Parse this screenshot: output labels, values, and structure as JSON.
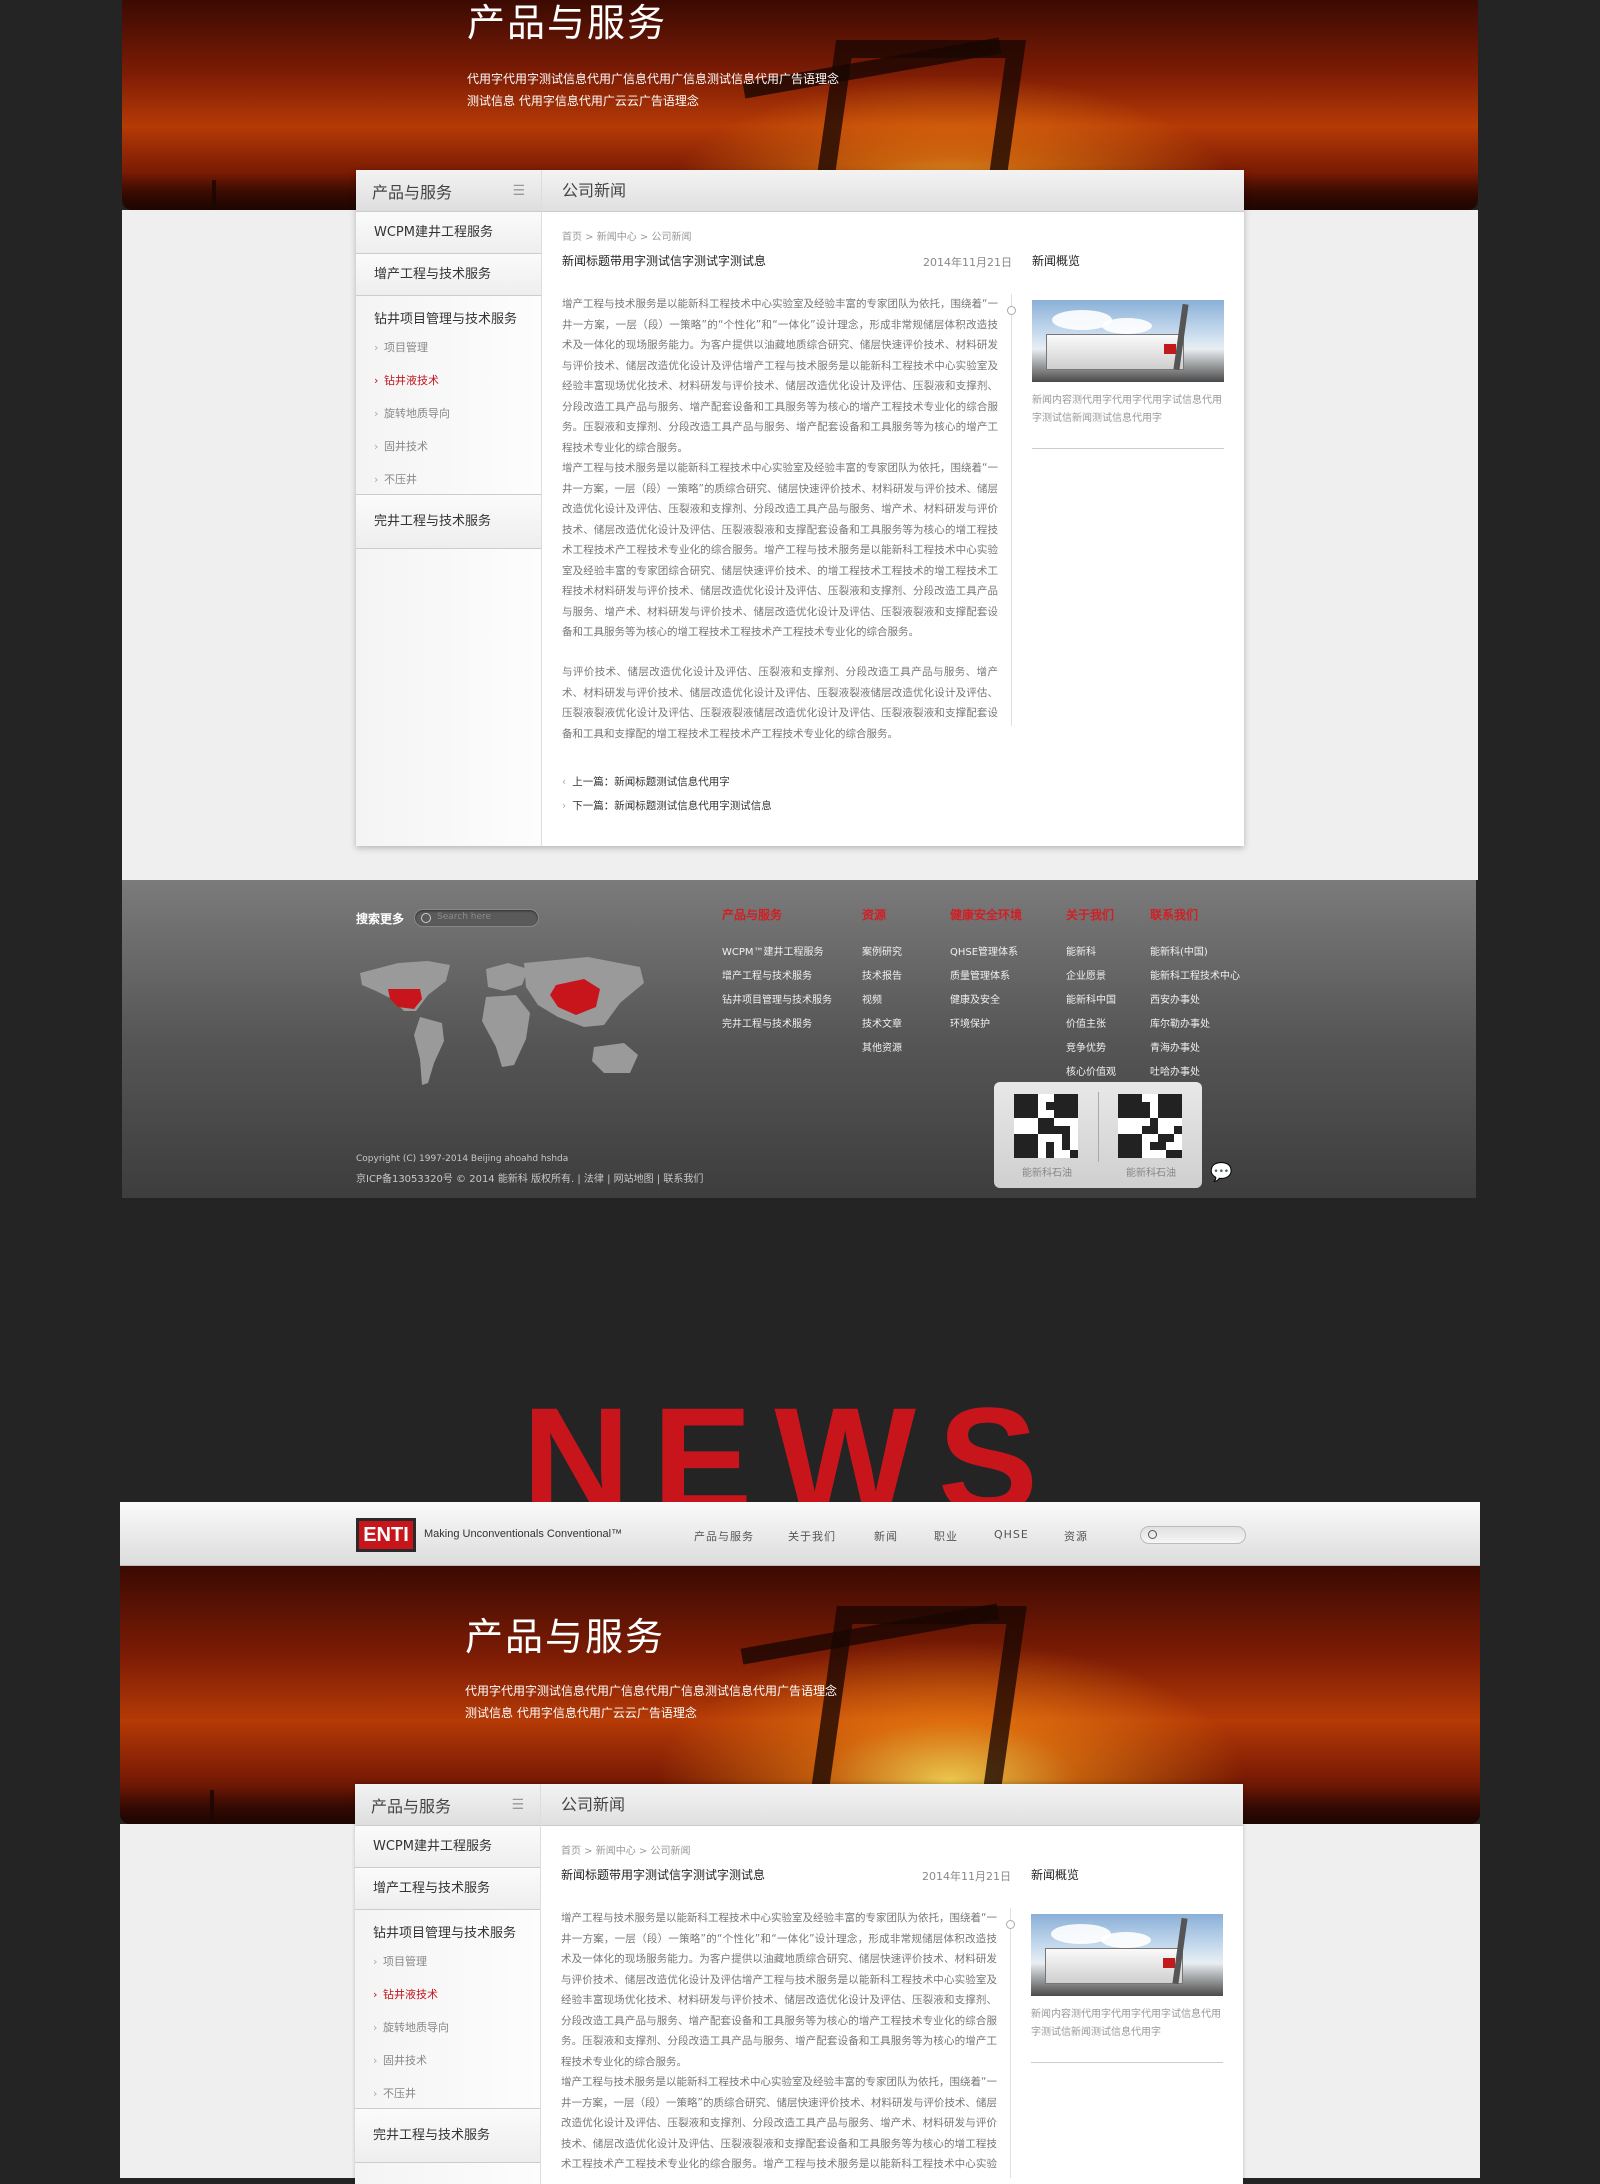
{
  "hero": {
    "title": "产品与服务",
    "desc_line1": "代用字代用字测试信息代用广信息代用广信息测试信息代用广告语理念",
    "desc_line2": "测试信息 代用字信息代用广云云广告语理念"
  },
  "sidebar": {
    "heading": "产品与服务",
    "items": [
      "WCPM建井工程服务",
      "增产工程与技术服务",
      "钻井项目管理与技术服务",
      "完井工程与技术服务"
    ],
    "subitems": [
      "项目管理",
      "钻井液技术",
      "旋转地质导向",
      "固井技术",
      "不压井"
    ],
    "active_subitem": "钻井液技术"
  },
  "article": {
    "section_title": "公司新闻",
    "breadcrumb": "首页 > 新闻中心 > 公司新闻",
    "title": "新闻标题带用字测试信字测试字测试息",
    "date": "2014年11月21日",
    "paragraphs": [
      "增产工程与技术服务是以能新科工程技术中心实验室及经验丰富的专家团队为依托，围绕着“一井一方案，一层（段）一策略”的“个性化”和“一体化”设计理念，形成非常规储层体积改造技术及一体化的现场服务能力。为客户提供以油藏地质综合研究、储层快速评价技术、材料研发与评价技术、储层改造优化设计及评估增产工程与技术服务是以能新科工程技术中心实验室及经验丰富现场优化技术、材料研发与评价技术、储层改造优化设计及评估、压裂液和支撑剂、分段改造工具产品与服务、增产配套设备和工具服务等为核心的增产工程技术专业化的综合服务。压裂液和支撑剂、分段改造工具产品与服务、增产配套设备和工具服务等为核心的增产工程技术专业化的综合服务。",
      "增产工程与技术服务是以能新科工程技术中心实验室及经验丰富的专家团队为依托，围绕着“一井一方案，一层（段）一策略”的质综合研究、储层快速评价技术、材料研发与评价技术、储层改造优化设计及评估、压裂液和支撑剂、分段改造工具产品与服务、增产术、材料研发与评价技术、储层改造优化设计及评估、压裂液裂液和支撑配套设备和工具服务等为核心的增工程技术工程技术产工程技术专业化的综合服务。增产工程与技术服务是以能新科工程技术中心实验室及经验丰富的专家团综合研究、储层快速评价技术、的增工程技术工程技术的增工程技术工程技术材料研发与评价技术、储层改造优化设计及评估、压裂液和支撑剂、分段改造工具产品与服务、增产术、材料研发与评价技术、储层改造优化设计及评估、压裂液裂液和支撑配套设备和工具服务等为核心的增工程技术工程技术产工程技术专业化的综合服务。",
      "与评价技术、储层改造优化设计及评估、压裂液和支撑剂、分段改造工具产品与服务、增产术、材料研发与评价技术、储层改造优化设计及评估、压裂液裂液储层改造优化设计及评估、压裂液裂液优化设计及评估、压裂液裂液储层改造优化设计及评估、压裂液裂液和支撑配套设备和工具和支撑配的增工程技术工程技术产工程技术专业化的综合服务。"
    ],
    "prev": "上一篇：新闻标题测试信息代用字",
    "next": "下一篇：新闻标题测试信息代用字测试信息"
  },
  "overview": {
    "title": "新闻概览",
    "caption": "新闻内容测代用字代用字代用字试信息代用字测试信新闻测试信息代用字"
  },
  "footer": {
    "search_label": "搜索更多",
    "search_placeholder": "Search here",
    "columns": [
      {
        "heading": "产品与服务",
        "links": [
          "WCPM™建井工程服务",
          "增产工程与技术服务",
          "钻井项目管理与技术服务",
          "完井工程与技术服务"
        ]
      },
      {
        "heading": "资源",
        "links": [
          "案例研究",
          "技术报告",
          "视频",
          "技术文章",
          "其他资源"
        ]
      },
      {
        "heading": "健康安全环境",
        "links": [
          "QHSE管理体系",
          "质量管理体系",
          "健康及安全",
          "环境保护"
        ]
      },
      {
        "heading": "关于我们",
        "links": [
          "能新科",
          "企业愿景",
          "能新科中国",
          "价值主张",
          "竞争优势",
          "核心价值观"
        ]
      },
      {
        "heading": "联系我们",
        "links": [
          "能新科(中国)",
          "能新科工程技术中心",
          "西安办事处",
          "库尔勒办事处",
          "青海办事处",
          "吐哈办事处"
        ]
      }
    ],
    "qr_label_1": "能新科石油",
    "qr_label_2": "能新科石油",
    "copyright": "Copyright (C) 1997-2014 Beijing ahoahd hshda",
    "icp": "京ICP备13053320号 © 2014 能新科 版权所有. | 法律 | 网站地图 | 联系我们"
  },
  "news_word": "NEWS",
  "header": {
    "logo": "ENTI",
    "tagline": "Making Unconventionals Conventional™",
    "nav": [
      "产品与服务",
      "关于我们",
      "新闻",
      "职业",
      "QHSE",
      "资源"
    ]
  },
  "colors": {
    "accent": "#c8151c",
    "footer_bg": "#565656",
    "body_bg": "#efefef"
  }
}
